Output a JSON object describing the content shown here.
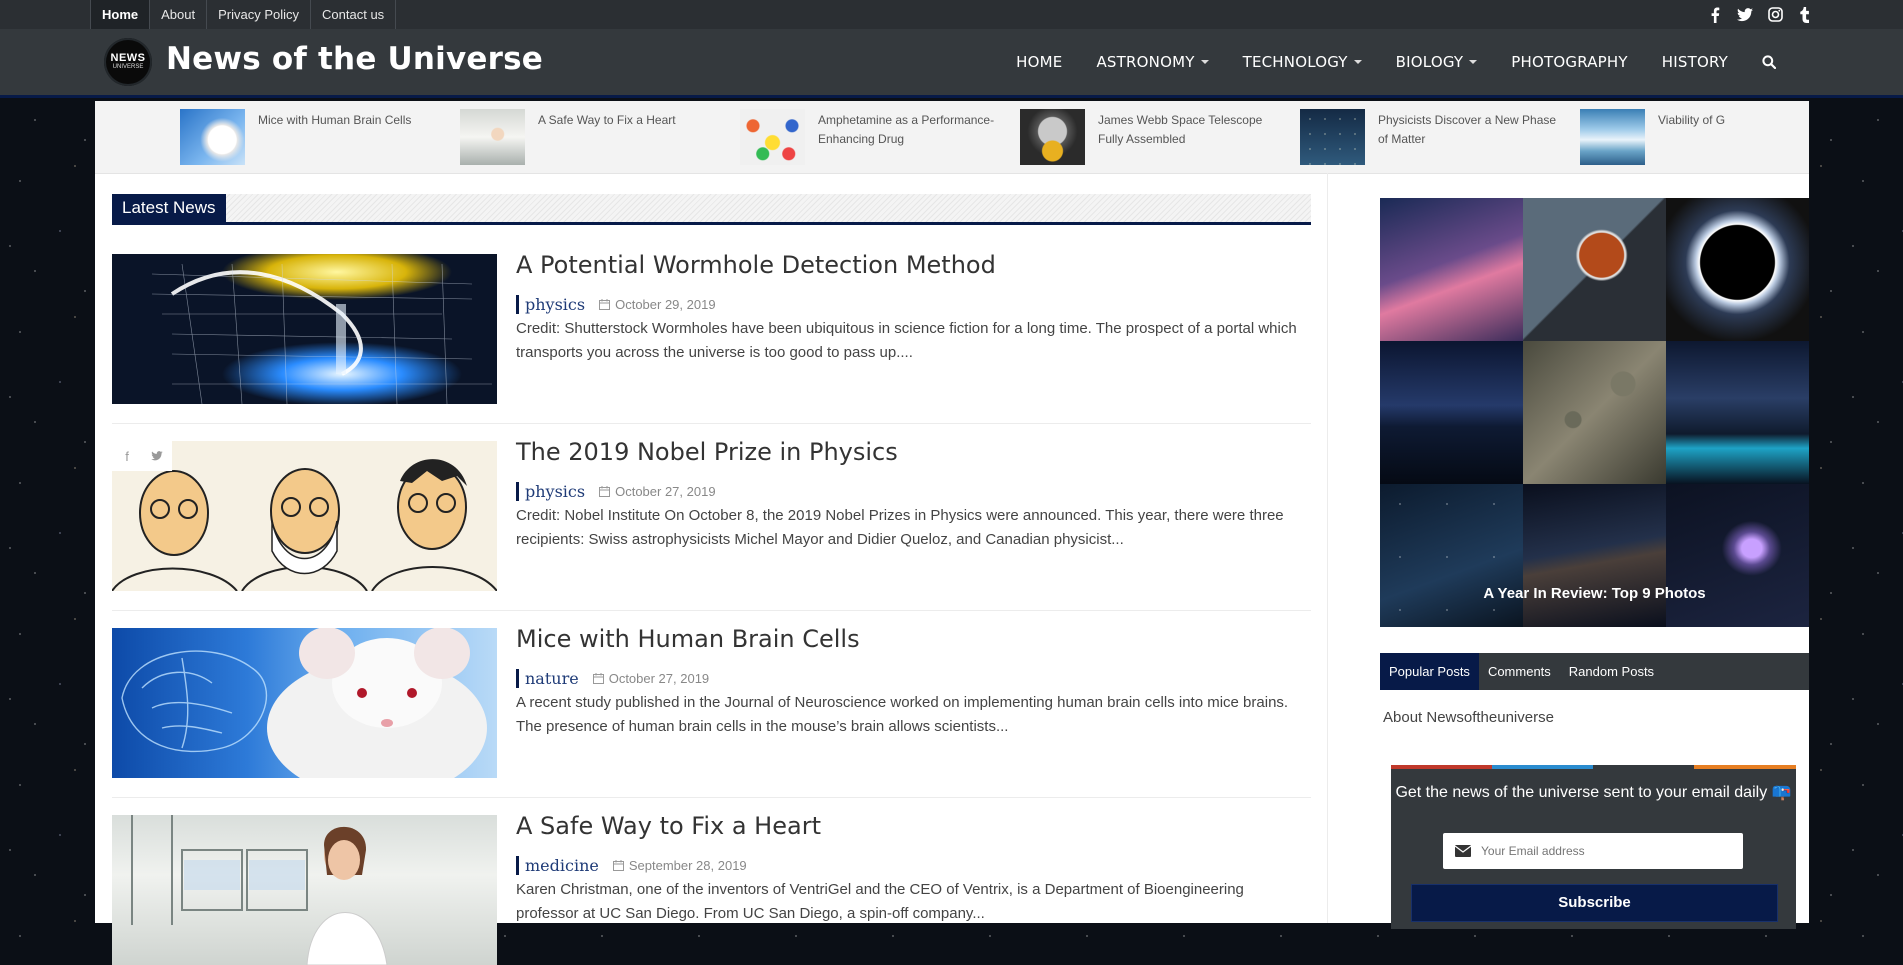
{
  "topbar": {
    "links": [
      "Home",
      "About",
      "Privacy Policy",
      "Contact us"
    ],
    "social_icons": [
      "facebook-icon",
      "twitter-icon",
      "instagram-icon",
      "tumblr-icon"
    ]
  },
  "header": {
    "logo_line1": "NEWS",
    "logo_line2": "UNIVERSE",
    "site_title": "News of the Universe",
    "nav": [
      "HOME",
      "ASTRONOMY",
      "TECHNOLOGY",
      "BIOLOGY",
      "PHOTOGRAPHY",
      "HISTORY"
    ],
    "search_icon": "search-icon"
  },
  "ticker": [
    "Mice with Human Brain Cells",
    "A Safe Way to Fix a Heart",
    "Amphetamine as a Performance-Enhancing Drug",
    "James Webb Space Telescope Fully Assembled",
    "Physicists Discover a New Phase of Matter",
    "Viability of G"
  ],
  "section_title": "Latest News",
  "posts": [
    {
      "title": "A Potential Wormhole Detection Method",
      "category": "physics",
      "date": "October 29, 2019",
      "excerpt": "Credit: Shutterstock Wormholes have been ubiquitous in science fiction for a long time. The prospect of a portal which transports you across the universe is too good to pass up...."
    },
    {
      "title": "The 2019 Nobel Prize in Physics",
      "category": "physics",
      "date": "October 27, 2019",
      "excerpt": "Credit: Nobel Institute On October 8, the 2019 Nobel Prizes in Physics were announced. This year, there were three recipients: Swiss astrophysicists Michel Mayor and Didier Queloz, and Canadian physicist..."
    },
    {
      "title": "Mice with Human Brain Cells",
      "category": "nature",
      "date": "October 27, 2019",
      "excerpt": "A recent study published in the Journal of Neuroscience worked on implementing human brain cells into mice brains. The presence of human brain cells in the mouse’s brain allows scientists..."
    },
    {
      "title": "A Safe Way to Fix a Heart",
      "category": "medicine",
      "date": "September 28, 2019",
      "excerpt": "Karen Christman, one of the inventors of VentriGel and the CEO of Ventrix, is a Department of Bioengineering professor at UC San Diego. From UC San Diego, a spin-off company..."
    }
  ],
  "sidebar": {
    "gallery_caption": "A Year In Review: Top 9 Photos",
    "tabs": [
      "Popular Posts",
      "Comments",
      "Random Posts"
    ],
    "about_link": "About Newsoftheuniverse",
    "subscribe_title": "Get the news of the universe sent to your email daily 📪",
    "email_placeholder": "Your Email address",
    "subscribe_button": "Subscribe"
  },
  "colors": {
    "accent_navy": "#071a48",
    "topbar": "#2b2f33",
    "header": "#34393d",
    "category_text": "#1f3b77"
  }
}
